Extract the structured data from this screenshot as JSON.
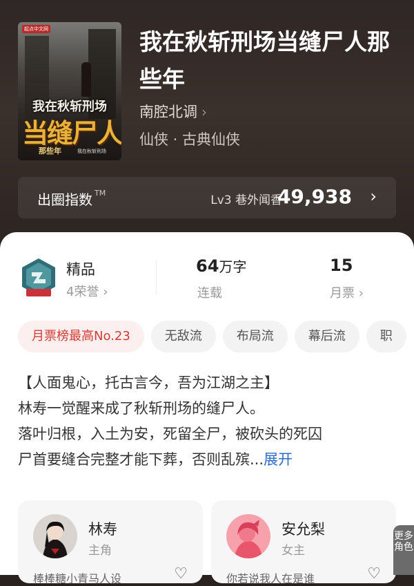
{
  "book": {
    "title": "我在秋斩刑场当缝尸人那些年",
    "author": "南腔北调",
    "genre": "仙侠 · 古典仙侠",
    "cover": {
      "publisher_mark": "起点中文网",
      "line1": "我在秋斩刑场",
      "line2": "当缝尸人",
      "line3": "那些年",
      "tag": "我在秋斩刑场"
    }
  },
  "index_bar": {
    "label": "出圈指数",
    "tm": "TM",
    "level": "Lv3 巷外闻香",
    "value": "49,938"
  },
  "stats": {
    "quality_label": "精品",
    "honors": "4荣誉",
    "words_value": "64",
    "words_unit": "万字",
    "words_label": "连载",
    "tickets_value": "15",
    "tickets_label": "月票"
  },
  "tags": [
    "月票榜最高No.23",
    "无敌流",
    "布局流",
    "幕后流",
    "职"
  ],
  "synopsis": {
    "line1": "【人面鬼心，托古言今，吾为江湖之主】",
    "line2": "林寿一觉醒来成了秋斩刑场的缝尸人。",
    "line3": "落叶归根，入土为安，死留全尸，被砍头的死囚",
    "line4": "尸首要缝合完整才能下葬，否则乱殡...",
    "expand": "展开"
  },
  "characters": [
    {
      "name": "林寿",
      "role": "主角",
      "line": "棒棒糖小青马人设"
    },
    {
      "name": "安允梨",
      "role": "女主",
      "line": "你若说我人在是谁"
    }
  ],
  "more_roles": "更多角色",
  "colors": {
    "header_bg": "#2f2725",
    "accent_red": "#d33b35",
    "link_blue": "#2d6cc9"
  }
}
